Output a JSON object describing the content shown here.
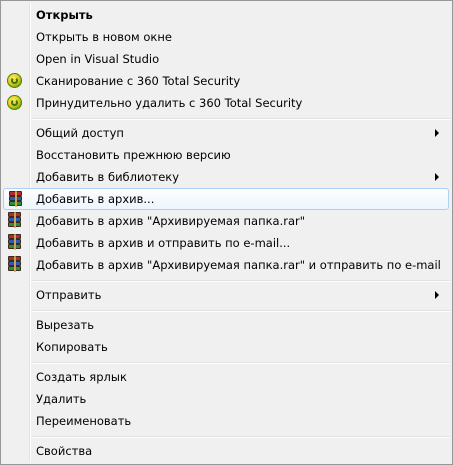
{
  "menu": {
    "items": [
      {
        "label": "Открыть"
      },
      {
        "label": "Открыть в новом окне"
      },
      {
        "label": "Open in Visual Studio"
      },
      {
        "label": "Сканирование с 360 Total Security",
        "icon": "360-total-security-icon"
      },
      {
        "label": "Принудительно удалить с  360 Total Security",
        "icon": "360-total-security-icon"
      },
      {
        "label": "Общий доступ",
        "submenu": true
      },
      {
        "label": "Восстановить прежнюю версию"
      },
      {
        "label": "Добавить в библиотеку",
        "submenu": true
      },
      {
        "label": "Добавить в архив...",
        "icon": "winrar-archive-icon",
        "highlighted": true
      },
      {
        "label": "Добавить в архив \"Архивируемая папка.rar\"",
        "icon": "winrar-archive-icon"
      },
      {
        "label": "Добавить в архив и отправить по e-mail...",
        "icon": "winrar-archive-icon"
      },
      {
        "label": "Добавить в архив \"Архивируемая папка.rar\" и отправить по e-mail",
        "icon": "winrar-archive-icon"
      },
      {
        "label": "Отправить",
        "submenu": true
      },
      {
        "label": "Вырезать"
      },
      {
        "label": "Копировать"
      },
      {
        "label": "Создать ярлык"
      },
      {
        "label": "Удалить"
      },
      {
        "label": "Переименовать"
      },
      {
        "label": "Свойства"
      }
    ]
  },
  "colors": {
    "background": "#f0f0f0",
    "border": "#979797",
    "highlight_border": "#aecff7"
  }
}
